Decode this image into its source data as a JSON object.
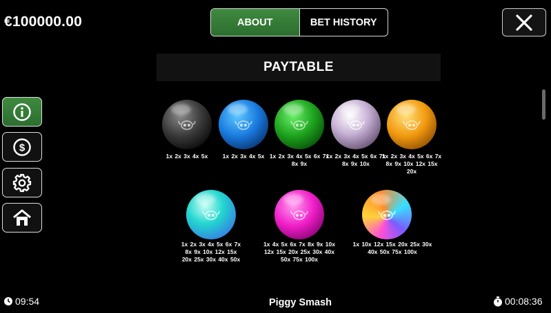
{
  "header": {
    "balance": "€100000.00",
    "tabs": [
      {
        "label": "ABOUT",
        "active": true
      },
      {
        "label": "BET HISTORY",
        "active": false
      }
    ],
    "close_icon": "close-icon"
  },
  "paytable": {
    "title": "PAYTABLE",
    "balls": [
      {
        "color": "black",
        "payouts": "1x 2x 3x 4x 5x"
      },
      {
        "color": "blue",
        "payouts": "1x 2x 3x 4x 5x"
      },
      {
        "color": "green",
        "payouts": "1x 2x 3x 4x 5x 6x 7x 8x 9x"
      },
      {
        "color": "pearl",
        "payouts": "1x 2x 3x 4x 5x 6x 7x 8x 9x 10x"
      },
      {
        "color": "gold",
        "payouts": "1x 2x 3x 4x 5x 6x 7x 8x 9x 10x 12x 15x 20x"
      },
      {
        "color": "cyan",
        "payouts": "1x 2x 3x 4x 5x 6x 7x 8x 9x 10x 12x 15x 20x 25x 30x 40x 50x"
      },
      {
        "color": "magenta",
        "payouts": "1x 4x 5x 6x 7x 8x 9x 10x 12x 15x 20x 25x 30x 40x 50x 75x 100x"
      },
      {
        "color": "rainbow",
        "payouts": "1x 10x 12x 15x 20x 25x 30x 40x 50x 75x 100x"
      }
    ]
  },
  "sidebar": {
    "items": [
      {
        "icon": "info-icon",
        "active": true
      },
      {
        "icon": "dollar-icon",
        "active": false
      },
      {
        "icon": "gear-icon",
        "active": false
      },
      {
        "icon": "home-icon",
        "active": false
      }
    ]
  },
  "footer": {
    "clock": "09:54",
    "game_title": "Piggy Smash",
    "session_timer": "00:08:36"
  },
  "colors": {
    "accent_green": "#2f7a32",
    "background": "#000000"
  }
}
